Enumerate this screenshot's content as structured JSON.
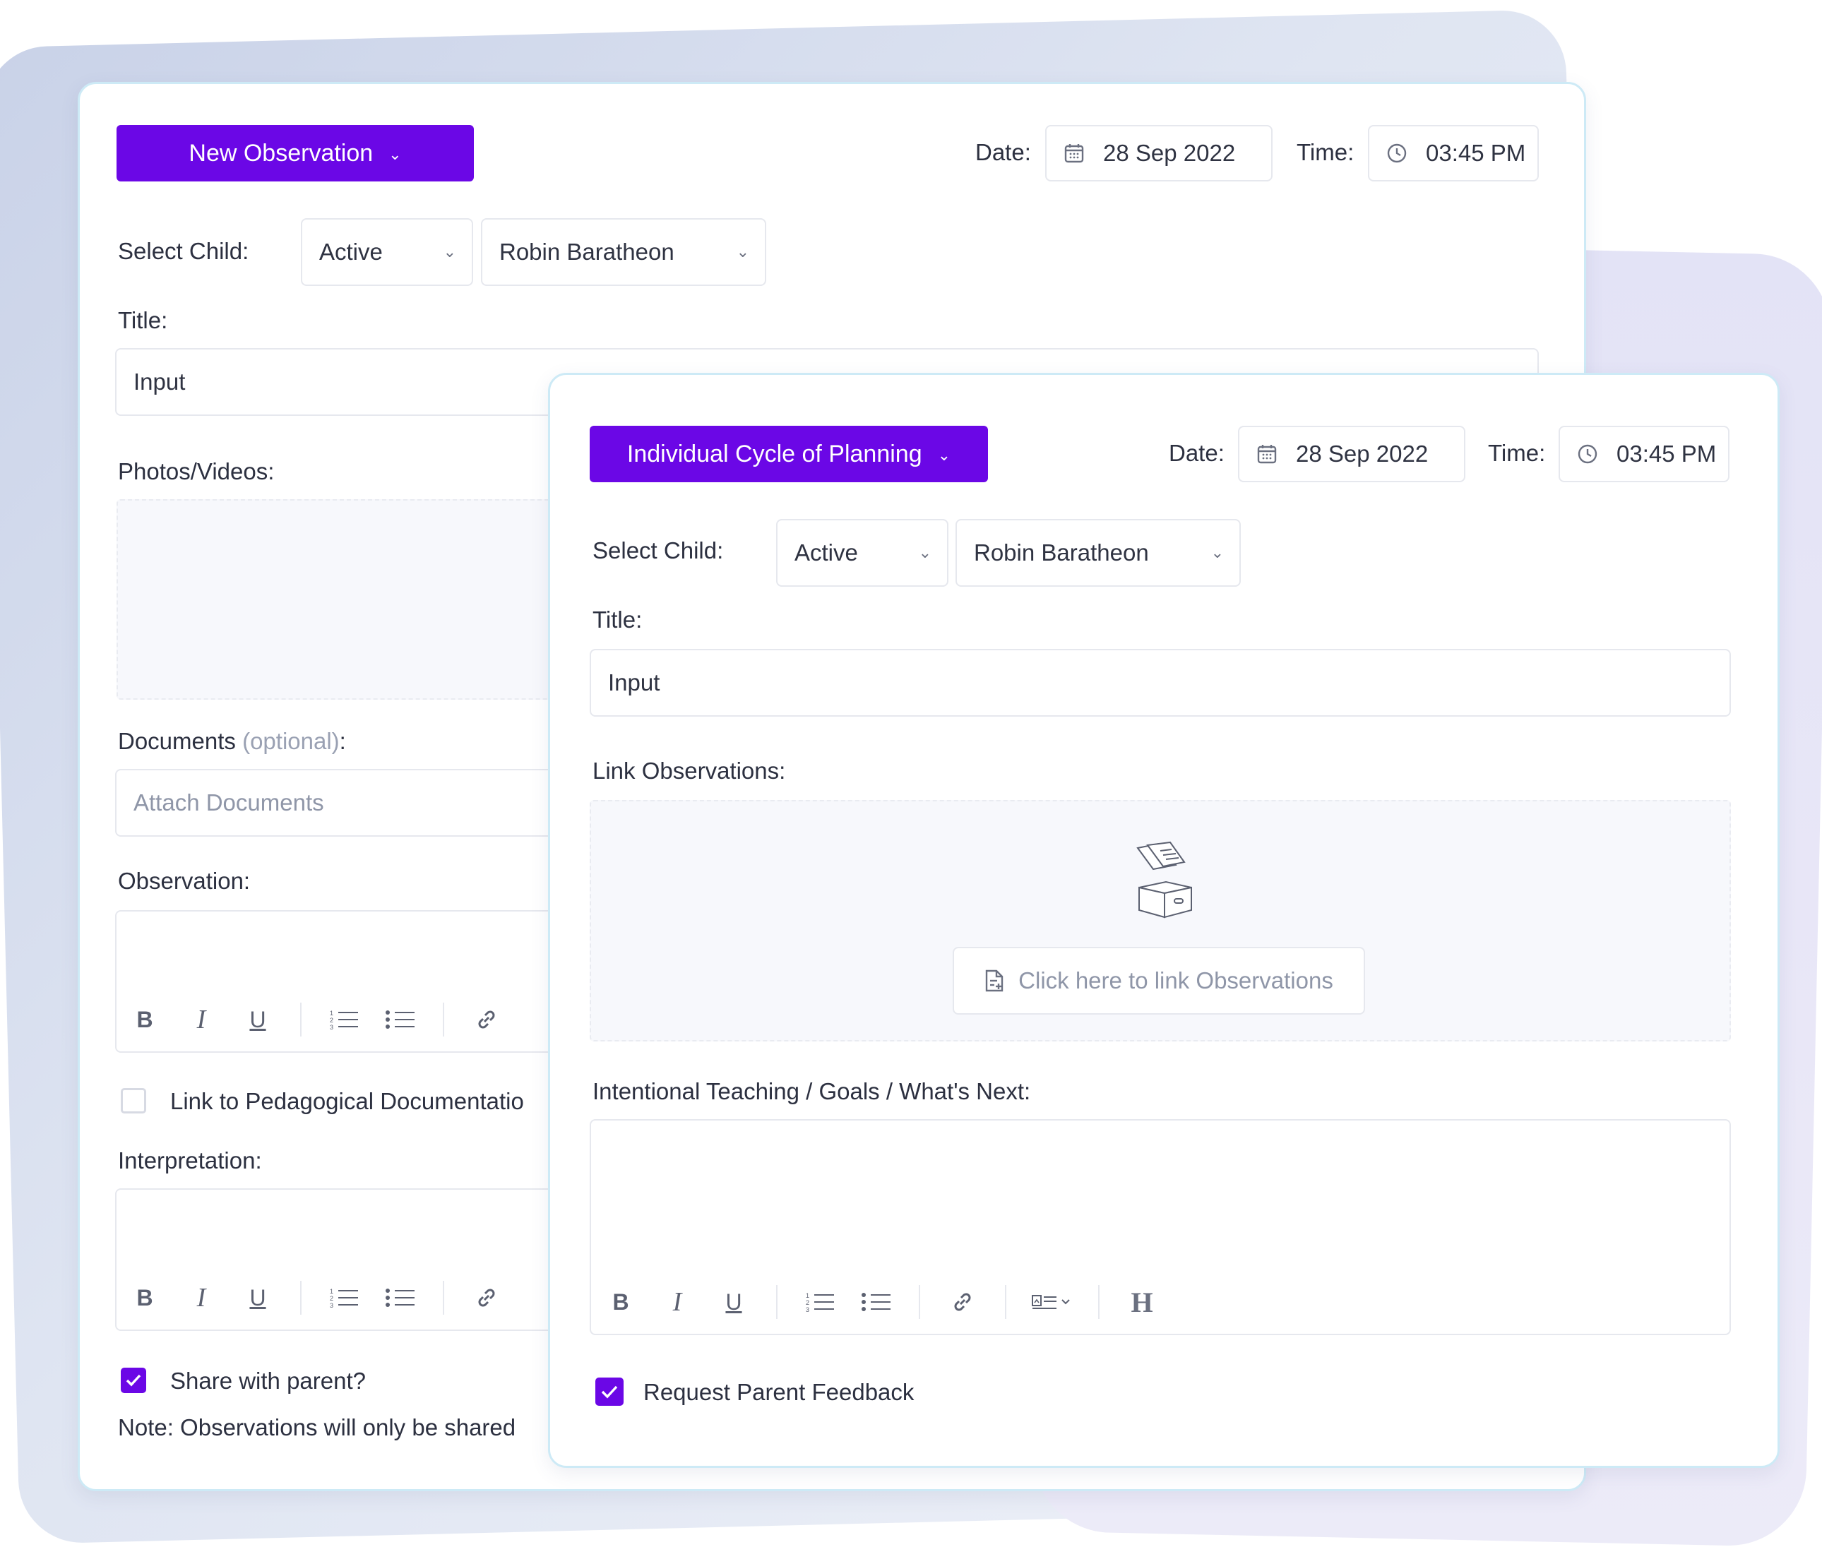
{
  "colors": {
    "primary": "#6b07e6",
    "card_border": "#cdeaf6",
    "muted_text": "#9aa1b3"
  },
  "back_form": {
    "type_button": "New Observation",
    "date_label": "Date:",
    "date_value": "28 Sep 2022",
    "time_label": "Time:",
    "time_value": "03:45 PM",
    "select_child_label": "Select Child:",
    "status_select": "Active",
    "child_select": "Robin Baratheon",
    "title_label": "Title:",
    "title_value": "Input",
    "photos_label": "Photos/Videos:",
    "documents_label": "Documents",
    "documents_optional": "(optional)",
    "documents_colon": ":",
    "attach_placeholder": "Attach Documents",
    "observation_label": "Observation:",
    "link_pedagogical_label": "Link to Pedagogical Documentatio",
    "interpretation_label": "Interpretation:",
    "share_label": "Share with parent?",
    "share_checked": true,
    "note_text": "Note: Observations will only be shared"
  },
  "front_form": {
    "type_button": "Individual Cycle of Planning",
    "date_label": "Date:",
    "date_value": "28 Sep 2022",
    "time_label": "Time:",
    "time_value": "03:45 PM",
    "select_child_label": "Select Child:",
    "status_select": "Active",
    "child_select": "Robin Baratheon",
    "title_label": "Title:",
    "title_value": "Input",
    "link_observations_label": "Link Observations:",
    "link_observations_button": "Click here to link Observations",
    "intentional_label": "Intentional Teaching / Goals / What's Next:",
    "request_feedback_label": "Request Parent Feedback",
    "request_feedback_checked": true
  },
  "icons": [
    "calendar-icon",
    "clock-icon",
    "chevron-down-icon",
    "bold-icon",
    "italic-icon",
    "underline-icon",
    "ordered-list-icon",
    "bullet-list-icon",
    "link-icon",
    "format-dropdown-icon",
    "heading-icon",
    "document-add-icon",
    "box-illustration",
    "check-icon"
  ]
}
